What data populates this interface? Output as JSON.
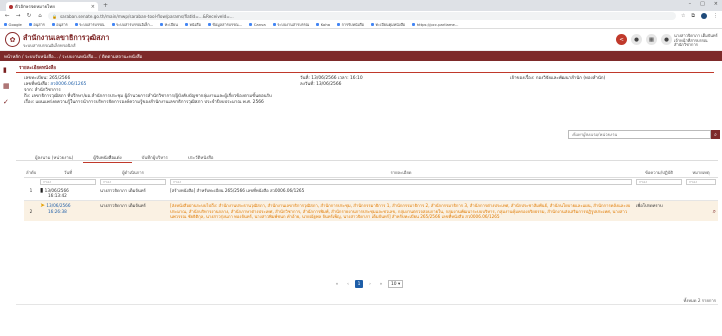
{
  "browser": {
    "tab_title": "ตัวอักษรจดหมายไทย",
    "tab_close": "×",
    "new_tab": "+",
    "win_min": "–",
    "win_max": "□",
    "win_close": "×",
    "back": "←",
    "forward": "→",
    "reload": "↻",
    "home": "⌂",
    "url": "saraban.senate.go.th/main/mwp/saraban-tool-flow/params/flatId=...&ReceiveId=...",
    "bookmarks": [
      "Google",
      "อนุสาร",
      "อนุสาร",
      "ระบบสารบรรณ",
      "ระบบสารบรรณอิเล็ก...",
      "ทะเบียน",
      "หนังสือ",
      "ข้อมูลสารบรรณ...",
      "Canva",
      "ระบบงานสารบรรณ",
      "Koha",
      "การรับหนังสือ",
      "ทะเบียนคุมหนังสือ",
      "https://pcc.parliame..."
    ]
  },
  "header": {
    "logo": "✿",
    "org_name": "สำนักงานเลขาธิการวุฒิสภา",
    "org_sub": "ระบบสารบรรณอิเล็กทรอนิกส์",
    "share_icon": "<",
    "bell_icon": "●",
    "grid_icon": "▦",
    "user_icon": "●",
    "user_name": "นางสาวจิดาภา เต็มจันทร์",
    "user_unit": "เจ้าหน้าที่สารบรรณ",
    "user_unit2": "สำนักวิชาการ"
  },
  "breadcrumb": "หน้าหลัก / ระบบรับหนังสือ... / ระบบงานหนังสือ... / ติดตามสถานะหนังสือ",
  "side_icons": [
    "▮",
    "▦",
    "✓"
  ],
  "panel": {
    "title": "รายละเอียดหนังสือ",
    "receive_no_label": "เลขทะเบียน:",
    "receive_no": "265/2566",
    "doc_no_label": "เลขที่หนังสือ:",
    "doc_no": "สว0006.06/1265",
    "from_label": "จาก:",
    "from": "สำนักวิชาการ",
    "to_label": "ถึง:",
    "to": "เลขาธิการวุฒิสภา ที่ปรึกษา/ผอ.สำนักการประชุม ผู้อำนวยการสำนักวิชาการ/ผู้บังคับบัญชากลุ่มงานและผู้เกี่ยวข้องตามขั้นตอนรับ",
    "subject_label": "เรื่อง:",
    "subject": "แผนแพร่งดความรู้ในการนำการบริหารจัดการองค์ความรู้ของสำนักงานเลขาธิการวุฒิสภา ประจำปีงบประมาณ พ.ศ. 2566",
    "date_label": "วันที่:",
    "date": "13/06/2566",
    "time_label": "เวลา:",
    "time": "16:10",
    "send_date_label": "ลงวันที่:",
    "send_date": "13/06/2566",
    "owner_label": "เจ้าของเรื่อง:",
    "owner": "กองวิจัยและพัฒนาสำนัก (ทองสำนัก)"
  },
  "search": {
    "placeholder": "ค้นหาผู้ลงนาม/หน่วยงาน",
    "button_icon": "⌕"
  },
  "tabs": [
    "ผู้ลงนาม (หน่วยงาน)",
    "ผู้รับหนังสือแต่ง",
    "บันทึกผู้บริหาร",
    "ประวัติหนังสือ"
  ],
  "table": {
    "headers": [
      "ลำดับ",
      "วันที่",
      "ผู้ดำเนินการ",
      "รายละเอียด",
      "ข้อความ/ปฏิบัติ",
      "หมายเหตุ"
    ],
    "filter_placeholder": "กรอง",
    "rows": [
      {
        "no": "1",
        "icon": "▮",
        "date": "13/06/2566",
        "time": "16:13:42",
        "actor": "นางสาวจิดาภา เต็มจันทร์",
        "detail": "[สร้างหนังสือ] สำหรับทะเบียน 265/2566 เลขที่หนังสือ สว0006.06/1265",
        "action": "",
        "note": ""
      },
      {
        "no": "2",
        "icon": "➤",
        "date": "13/06/2566",
        "time": "16:26:38",
        "actor": "นางสาวจิดาภา เต็มจันทร์",
        "detail": "[ส่งหนังสือผ่านระบบไปถึง: สำนักงานประธานวุฒิสภา, สำนักงานเลขาธิการวุฒิสภา, สำนักการประชุม, สำนักกรรมาธิการ 1, สำนักกรรมาธิการ 2, สำนักกรรมาธิการ 3, สำนักการต่างประเทศ, สำนักประชาสัมพันธ์, สำนักนโยบายและแผน, สำนักการคลังและงบประมาณ, สำนักบริหารงานกลาง, สำนักภาษาต่างประเทศ, สำนักวิชาการ, สำนักการพิมพ์, สำนักรายงานการประชุมและชวเลข, กลุ่มงานตรวจสอบภายใน, กลุ่มงานพัฒนาระบบบริหาร, กลุ่มงานคุ้มครองจริยธรรม, สำนักงานส่งเสริมการปฏิรูปประเทศ, นางสาวนพวรรณ ชัยธิติกุล, นางสาวรุ่งนภา ทองจันทร์, นางสาวพิมพ์ชนก คำอ้าย, นายณัฐพล จันทร์เพ็ญ, นางสาวจิดาภา เต็มจันทร์] สำหรับทะเบียน 265/2566 เลขที่หนังสือ สว0006.06/1265",
        "action": "เพื่อโปรดทราบ",
        "note": ""
      }
    ],
    "zoom_icon": "⌕"
  },
  "pager": {
    "first": "«",
    "prev": "‹",
    "current": "1",
    "next": "›",
    "last": "»",
    "page_size": "10 ▾"
  },
  "total": "ทั้งหมด 2 รายการ"
}
